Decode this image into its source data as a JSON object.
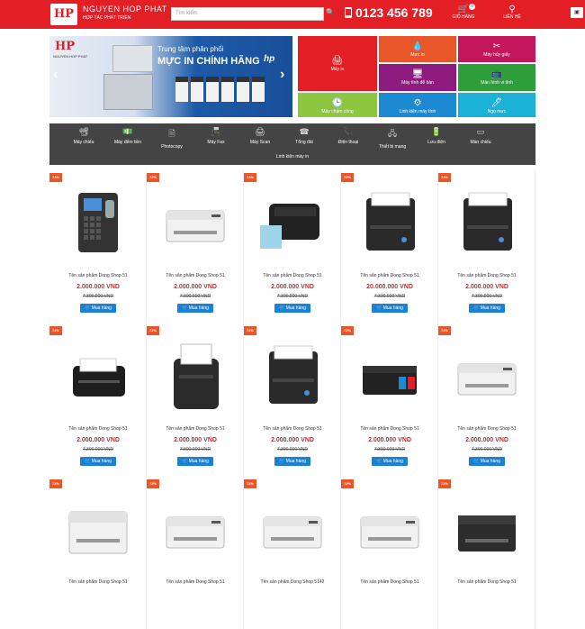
{
  "header": {
    "logo_text": "HP",
    "brand_name": "NGUYEN HOP PHAT",
    "brand_tagline": "HỢP TÁC PHÁT TRIỂN",
    "search_placeholder": "Tìm kiếm",
    "hotline": "0123 456 789",
    "cart_label": "GIỎ HÀNG",
    "cart_count": "0",
    "contact_label": "LIÊN HỆ"
  },
  "banner": {
    "logo": "HP",
    "logo_text": "NGUYEN HOP PHAT",
    "line1": "Trung tâm phân phối",
    "line2": "MỰC IN CHÍNH HÃNG",
    "brand_mark": "hp"
  },
  "tiles": [
    {
      "label": "Máy in",
      "color": "#e31e24"
    },
    {
      "label": "Mực in",
      "color": "#e8562a"
    },
    {
      "label": "Máy hủy giấy",
      "color": "#c2185b"
    },
    {
      "label": "Máy tính để bàn",
      "color": "#8e1b80"
    },
    {
      "label": "Màn hình vi tính",
      "color": "#2e9e3a"
    },
    {
      "label": "Máy chấm công",
      "color": "#8dc63f"
    },
    {
      "label": "Linh kiện máy tính",
      "color": "#1b8ad3"
    },
    {
      "label": "Ngọ mực",
      "color": "#1cb1d6"
    }
  ],
  "categories": [
    "Máy chiếu",
    "Máy đếm tiền",
    "Photocopy",
    "Máy Fax",
    "Máy Scan",
    "Tổng đài",
    "Điện thoại",
    "Thiết bị mạng",
    "Lưu điện",
    "Màn chiếu"
  ],
  "category_extra": "Linh kiện máy in",
  "products": [
    {
      "name": "Tên sản phẩm Dong Shop 51",
      "price": "2.000.000 VND",
      "old": "7.300.000 VND",
      "kind": "attendance"
    },
    {
      "name": "Tên sản phẩm Dong Shop 51",
      "price": "2.000.000 VND",
      "old": "7.300.000 VND",
      "kind": "laser-white"
    },
    {
      "name": "Tên sản phẩm Dong Shop 51",
      "price": "2.000.000 VND",
      "old": "7.300.000 VND",
      "kind": "label"
    },
    {
      "name": "Tên sản phẩm Dong Shop 51",
      "price": "20.000.000 VND",
      "old": "7.300.000 VND",
      "kind": "receipt"
    },
    {
      "name": "Tên sản phẩm Dong Shop 51",
      "price": "2.000.000 VND",
      "old": "7.300.000 VND",
      "kind": "receipt"
    },
    {
      "name": "Tên sản phẩm Dong Shop 51",
      "price": "2.000.000 VND",
      "old": "7.300.000 VND",
      "kind": "mobile"
    },
    {
      "name": "Tên sản phẩm Dong Shop 51",
      "price": "2.000.000 VND",
      "old": "7.300.000 VND",
      "kind": "receipt-tall"
    },
    {
      "name": "Tên sản phẩm Dong Shop 51",
      "price": "2.000.000 VND",
      "old": "7.300.000 VND",
      "kind": "receipt"
    },
    {
      "name": "Tên sản phẩm Dong Shop 51",
      "price": "2.000.000 VND",
      "old": "7.300.000 VND",
      "kind": "inkjet-black"
    },
    {
      "name": "Tên sản phẩm Dong Shop 51",
      "price": "2.000.000 VND",
      "old": "7.300.000 VND",
      "kind": "laser-white"
    },
    {
      "name": "Tên sản phẩm Dong Shop 51",
      "price": "",
      "old": "",
      "kind": "mfp-white"
    },
    {
      "name": "Tên sản phẩm Dong Shop 51",
      "price": "",
      "old": "",
      "kind": "laser-white"
    },
    {
      "name": "Tên sản phẩm Dong Shop 5142",
      "price": "",
      "old": "",
      "kind": "laser-white"
    },
    {
      "name": "Tên sản phẩm Dong Shop 51",
      "price": "",
      "old": "",
      "kind": "laser-white"
    },
    {
      "name": "Tên sản phẩm Dong Shop 51",
      "price": "",
      "old": "",
      "kind": "laser-black"
    }
  ],
  "ribbon_label": "72%",
  "buy_label": "Mua hàng"
}
